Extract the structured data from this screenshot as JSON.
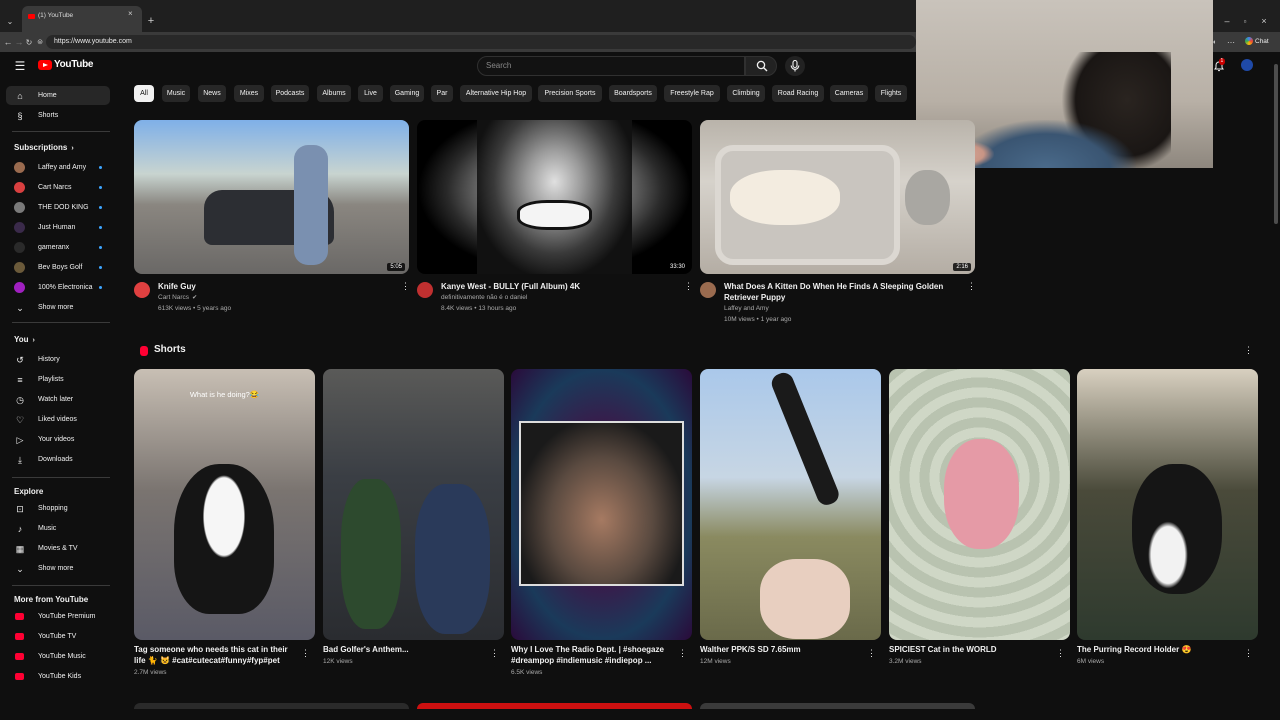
{
  "browser": {
    "tab_title": "(1) YouTube",
    "url": "https://www.youtube.com",
    "chat_label": "Chat"
  },
  "header": {
    "logo_text": "YouTube",
    "search_placeholder": "Search",
    "notification_count": "1"
  },
  "sidebar": {
    "main": [
      {
        "label": "Home",
        "icon": "home-icon"
      },
      {
        "label": "Shorts",
        "icon": "shorts-icon"
      }
    ],
    "subscriptions_title": "Subscriptions",
    "subscriptions": [
      {
        "label": "Laffey and Amy",
        "color": "#9a6b4f"
      },
      {
        "label": "Cart Narcs",
        "color": "#d94040"
      },
      {
        "label": "THE DOD KING",
        "color": "#7a7a7a"
      },
      {
        "label": "Just Human",
        "color": "#3a2a4a"
      },
      {
        "label": "gameranx",
        "color": "#2a2a2a"
      },
      {
        "label": "Bev Boys Golf",
        "color": "#6b5a3a"
      },
      {
        "label": "100% Electronica",
        "color": "#a020c0"
      }
    ],
    "show_more": "Show more",
    "you_title": "You",
    "you_items": [
      {
        "label": "History",
        "icon": "history-icon"
      },
      {
        "label": "Playlists",
        "icon": "playlists-icon"
      },
      {
        "label": "Watch later",
        "icon": "watch-later-icon"
      },
      {
        "label": "Liked videos",
        "icon": "like-icon"
      },
      {
        "label": "Your videos",
        "icon": "your-videos-icon"
      },
      {
        "label": "Downloads",
        "icon": "download-icon"
      }
    ],
    "explore_title": "Explore",
    "explore_items": [
      {
        "label": "Shopping",
        "icon": "shopping-icon"
      },
      {
        "label": "Music",
        "icon": "music-icon"
      },
      {
        "label": "Movies & TV",
        "icon": "movies-icon"
      }
    ],
    "more_title": "More from YouTube",
    "more_items": [
      {
        "label": "YouTube Premium"
      },
      {
        "label": "YouTube TV"
      },
      {
        "label": "YouTube Music"
      },
      {
        "label": "YouTube Kids"
      }
    ]
  },
  "chips": [
    "All",
    "Music",
    "News",
    "Mixes",
    "Podcasts",
    "Albums",
    "Live",
    "Gaming",
    "Par",
    "Alternative Hip Hop",
    "Precision Sports",
    "Boardsports",
    "Freestyle Rap",
    "Climbing",
    "Road Racing",
    "Cameras",
    "Flights"
  ],
  "videos": [
    {
      "title": "Knife Guy",
      "channel": "Cart Narcs",
      "verified": true,
      "stats": "613K views • 5 years ago",
      "duration": "5:05",
      "avatar_color": "#e04040"
    },
    {
      "title": "Kanye West - BULLY (Full Album) 4K",
      "channel": "definitivamente não é o daniel",
      "verified": false,
      "stats": "8.4K views • 13 hours ago",
      "duration": "33:30",
      "avatar_color": "#c03030"
    },
    {
      "title": "What Does A Kitten Do When He Finds A Sleeping Golden Retriever Puppy",
      "channel": "Laffey and Amy",
      "verified": false,
      "stats": "10M views • 1 year ago",
      "duration": "2:16",
      "avatar_color": "#9a6b4f"
    }
  ],
  "shorts_title": "Shorts",
  "shorts": [
    {
      "title": "Tag someone who needs this cat in their life 🐈 😺 #cat#cutecat#funny#fyp#pet",
      "views": "2.7M views",
      "overlay": "What is he doing?😂"
    },
    {
      "title": "Bad Golfer's Anthem...",
      "views": "12K views"
    },
    {
      "title": "Why I Love The Radio Dept. | #shoegaze #dreampop #indiemusic #indiepop ...",
      "views": "6.5K views"
    },
    {
      "title": "Walther PPK/S SD 7.65mm",
      "views": "12M views"
    },
    {
      "title": "SPICIEST Cat in the WORLD",
      "views": "3.2M views"
    },
    {
      "title": "The Purring Record Holder 😍",
      "views": "6M views"
    }
  ]
}
